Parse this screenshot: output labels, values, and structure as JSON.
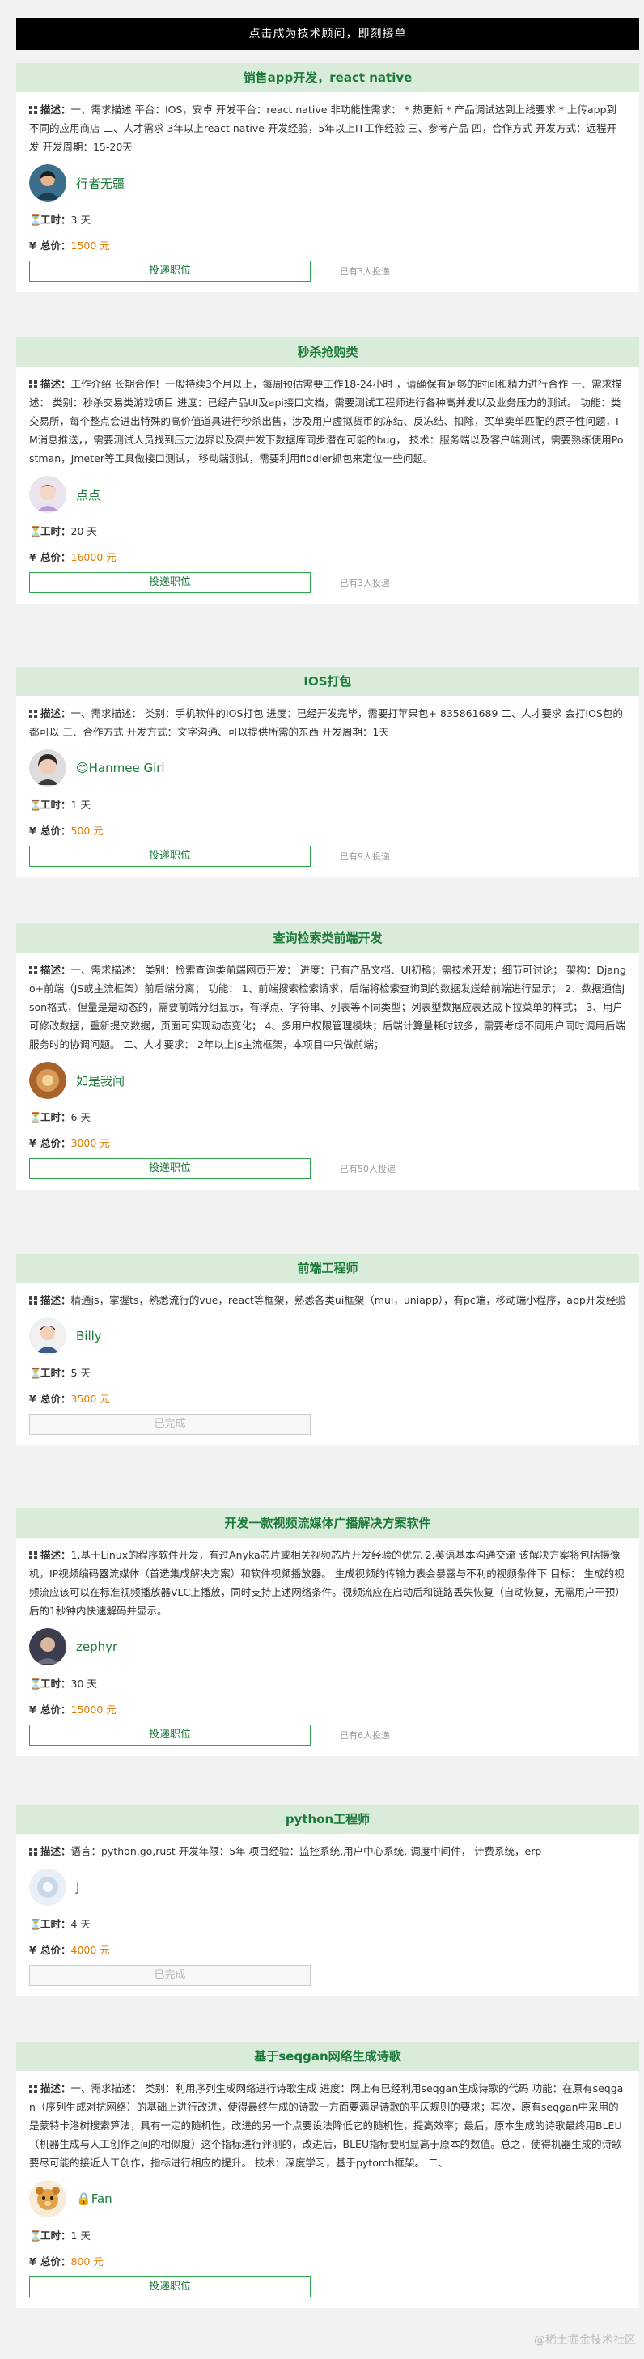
{
  "banner": "点击成为技术顾问，即刻接单",
  "labels": {
    "desc_label": "描述：",
    "hours_label": "工时：",
    "price_label": "总价：",
    "hours_icon": "⏳",
    "price_icon": "¥"
  },
  "cards": [
    {
      "title": "销售app开发，react native",
      "desc": "一、需求描述 平台：IOS，安卓 开发平台：react native 非功能性需求： * 热更新 * 产品调试达到上线要求 * 上传app到不同的应用商店 二、人才需求 3年以上react native 开发经验，5年以上IT工作经验 三、参考产品 四，合作方式 开发方式：远程开发 开发周期：15-20天",
      "user": "行者无疆",
      "hours": "3 天",
      "price": "1500 元",
      "button": "投递职位",
      "bids": "已有3人投递"
    },
    {
      "title": "秒杀抢购类",
      "desc": "工作介绍 长期合作！一般持续3个月以上，每周预估需要工作18-24小时 ，请确保有足够的时间和精力进行合作 一、需求描述： 类别：秒杀交易类游戏项目 进度：已经产品UI及api接口文档，需要测试工程师进行各种高并发以及业务压力的测试。 功能：类交易所，每个整点会进出特殊的高价值道具进行秒杀出售，涉及用户虚拟货币的冻结、反冻结、扣除，买单卖单匹配的原子性问题，IM消息推送，，需要测试人员找到压力边界以及高并发下数据库同步潜在可能的bug， 技术：服务端以及客户端测试，需要熟练使用Postman，Jmeter等工具做接口测试， 移动端测试，需要利用fiddler抓包来定位一些问题。",
      "user": "点点",
      "hours": "20 天",
      "price": "16000 元",
      "button": "投递职位",
      "bids": "已有3人投递"
    },
    {
      "title": "IOS打包",
      "desc": "一、需求描述： 类别：手机软件的IOS打包 进度：已经开发完毕，需要打苹果包+ 835861689 二、人才要求 会打IOS包的都可以 三、合作方式 开发方式：文字沟通、可以提供所需的东西 开发周期：1天",
      "user": "Hanmee Girl",
      "hours": "1 天",
      "price": "500 元",
      "button": "投递职位",
      "bids": "已有9人投递"
    },
    {
      "title": "查询检索类前端开发",
      "desc": "一、需求描述： 类别：检索查询类前端网页开发： 进度：已有产品文档、UI初稿；需技术开发；细节可讨论； 架构：Django+前端（JS或主流框架）前后端分离； 功能： 1、前端搜索检索请求，后端将检索查询到的数据发送给前端进行显示； 2、数据通信json格式，但量是是动态的，需要前端分组显示，有浮点、字符串、列表等不同类型；列表型数据应表达成下拉菜单的样式； 3、用户可修改数据，重新提交数据，页面可实现动态变化； 4、多用户权限管理模块；后端计算量耗时较多，需要考虑不同用户同时调用后端服务时的协调问题。 二、人才要求： 2年以上js主流框架，本项目中只做前端；",
      "user": "如是我闻",
      "hours": "6 天",
      "price": "3000 元",
      "button": "投递职位",
      "bids": "已有50人投递"
    },
    {
      "title": "前端工程师",
      "desc": "精通js，掌握ts，熟悉流行的vue，react等框架，熟悉各类ui框架（mui，uniapp），有pc端，移动端小程序，app开发经验",
      "user": "Billy",
      "hours": "5 天",
      "price": "3500 元",
      "button": "已完成",
      "bids": ""
    },
    {
      "title": "开发一款视频流媒体广播解决方案软件",
      "desc": "1.基于Linux的程序软件开发，有过Anyka芯片或相关视频芯片开发经验的优先 2.英语基本沟通交流 该解决方案将包括摄像机，IP视频编码器流媒体（首选集成解决方案）和软件视频播放器。 生成视频的传输力表会暴露与不利的视频条件下 目标： 生成的视频流应该可以在标准视频播放器VLC上播放，同时支持上述网络条件。视频流应在启动后和链路丢失恢复（自动恢复，无需用户干预）后的1秒钟内快速解码并显示。",
      "user": "zephyr",
      "hours": "30 天",
      "price": "15000 元",
      "button": "投递职位",
      "bids": "已有6人投递"
    },
    {
      "title": "python工程师",
      "desc": "语言：python,go,rust 开发年限：5年 项目经验：监控系统,用户中心系统, 调度中间件， 计费系统，erp",
      "user": "J",
      "hours": "4 天",
      "price": "4000 元",
      "button": "已完成",
      "bids": ""
    },
    {
      "title": "基于seqgan网络生成诗歌",
      "desc": "一、需求描述： 类别：利用序列生成网络进行诗歌生成 进度：网上有已经利用seqgan生成诗歌的代码 功能：在原有seqgan（序列生成对抗网络）的基础上进行改进，使得最终生成的诗歌一方面要满足诗歌的平仄规则的要求；其次，原有seqgan中采用的是蒙特卡洛树搜索算法，具有一定的随机性，改进的另一个点要设法降低它的随机性，提高效率；最后，原本生成的诗歌最终用BLEU（机器生成与人工创作之间的相似度）这个指标进行评测的，改进后，BLEU指标要明显高于原本的数值。总之，使得机器生成的诗歌要尽可能的接近人工创作，指标进行相应的提升。 技术：深度学习，基于pytorch框架。 二、",
      "user": "Fan",
      "hours": "1 天",
      "price": "800 元",
      "button": "投递职位",
      "bids": ""
    }
  ],
  "watermark": "@稀土掘金技术社区",
  "colors": {
    "header_bg": "#d9ecd9",
    "title_green": "#1b7a3a",
    "button_border": "#2aa54a",
    "price_orange": "#e07b00",
    "banner_bg": "#000000"
  }
}
